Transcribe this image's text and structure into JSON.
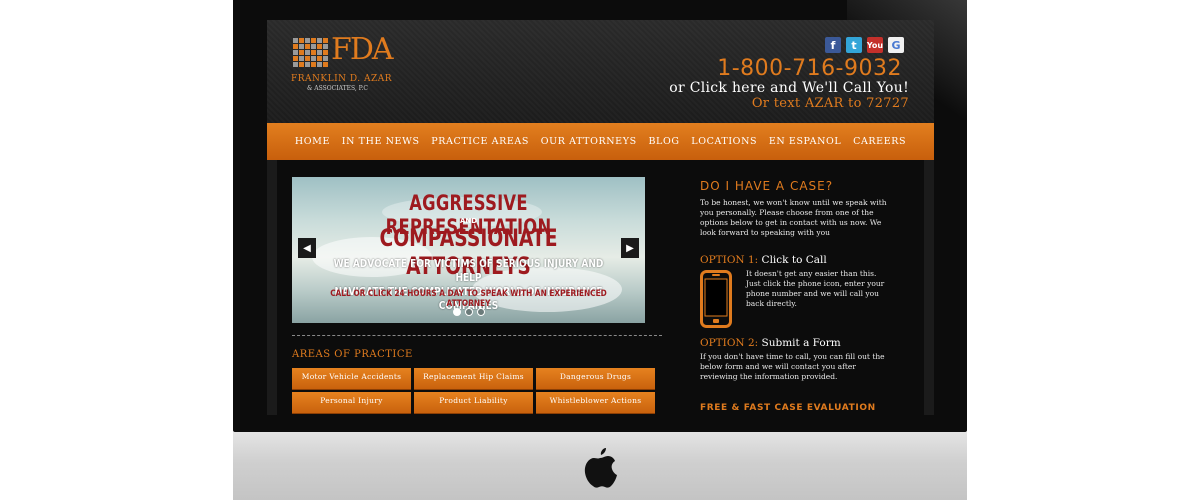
{
  "header": {
    "logo_mark": "FDA",
    "logo_name": "FRANKLIN D. AZAR",
    "logo_sub": "& ASSOCIATES, P.C",
    "phone": "1-800-716-9032",
    "call_text": "or Click here and We'll Call You!",
    "text_line": "Or text AZAR to 72727",
    "socials": [
      {
        "name": "facebook",
        "glyph": "f"
      },
      {
        "name": "twitter",
        "glyph": "t"
      },
      {
        "name": "youtube",
        "glyph": "You"
      },
      {
        "name": "google",
        "glyph": "G"
      }
    ]
  },
  "nav": [
    "HOME",
    "IN THE NEWS",
    "PRACTICE AREAS",
    "OUR ATTORNEYS",
    "BLOG",
    "LOCATIONS",
    "EN ESPANOL",
    "CAREERS"
  ],
  "slider": {
    "line1": "AGGRESSIVE REPRESENTATION",
    "and": "AND",
    "line2": "COMPASSIONATE ATTORNEYS",
    "line3a": "WE ADVOCATE FOR VICTIMS OF SERIOUS INJURY AND HELP",
    "line3b": "NAVIGATE THE COMPLICATED WORLD OF INSURANCE COMPANIES",
    "line4": "CALL OR CLICK 24 HOURS A DAY TO SPEAK WITH AN EXPERIENCED ATTORNEY",
    "prev": "◀",
    "next": "▶",
    "slide_count": 3,
    "active_slide": 1
  },
  "areas": {
    "title": "AREAS OF PRACTICE",
    "items": [
      "Motor Vehicle Accidents",
      "Replacement Hip Claims",
      "Dangerous Drugs",
      "Personal Injury",
      "Product Liability",
      "Whistleblower Actions"
    ]
  },
  "case": {
    "title": "DO I HAVE A CASE?",
    "intro": "To be honest, we won't know until we speak with you personally. Please choose from one of the options below to get in contact with us now. We look forward to speaking with you",
    "option1_label": "OPTION 1:",
    "option1_title": "Click to Call",
    "option1_text": "It doesn't get any easier than this. Just click the phone icon, enter your phone number and we will call you back directly.",
    "option2_label": "OPTION 2:",
    "option2_title": "Submit a Form",
    "option2_text": "If you don't have time to call, you can fill out the below form and we will contact you after reviewing the information provided.",
    "evaluation": "FREE & FAST CASE EVALUATION"
  },
  "colors": {
    "accent": "#e07b1e",
    "headline_red": "#9e1a1f",
    "background": "#0c0c0c"
  }
}
